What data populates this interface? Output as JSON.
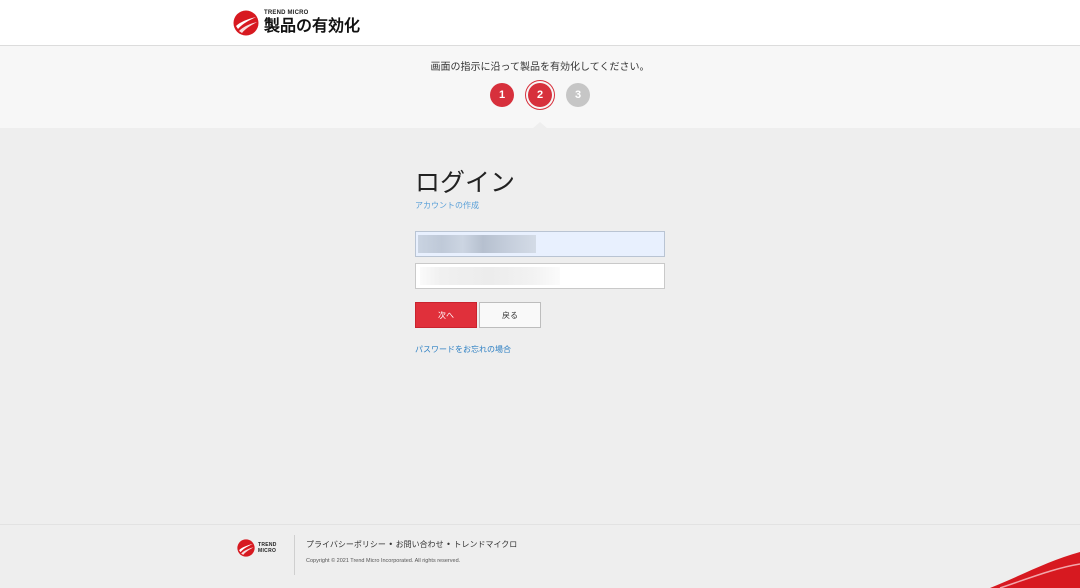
{
  "header": {
    "brand_small": "TREND MICRO",
    "title": "製品の有効化"
  },
  "steps": {
    "instruction": "画面の指示に沿って製品を有効化してください。",
    "items": [
      "1",
      "2",
      "3"
    ],
    "current": 2
  },
  "login": {
    "title": "ログイン",
    "create_account": "アカウントの作成",
    "next_label": "次へ",
    "back_label": "戻る",
    "forgot_password": "パスワードをお忘れの場合"
  },
  "footer": {
    "brand_line1": "TREND",
    "brand_line2": "MICRO",
    "links": "プライバシーポリシー • お問い合わせ • トレンドマイクロ",
    "copyright": "Copyright © 2021 Trend Micro Incorporated. All rights reserved."
  },
  "colors": {
    "accent": "#d7303c",
    "link": "#2c7fc3",
    "step_inactive": "#c6c6c6"
  }
}
